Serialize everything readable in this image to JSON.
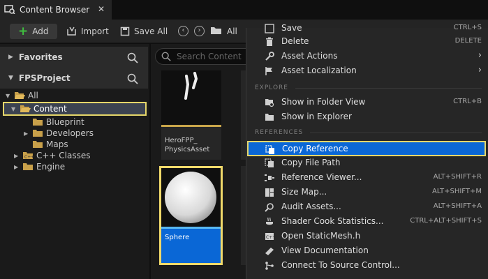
{
  "window": {
    "tab_title": "Content Browser",
    "close_glyph": "✕"
  },
  "toolbar": {
    "add_label": "Add",
    "import_label": "Import",
    "save_all_label": "Save All",
    "breadcrumb": "All"
  },
  "left_pane": {
    "favorites_label": "Favorites",
    "project_label": "FPSProject",
    "tree": [
      "All",
      "Content",
      "Blueprint",
      "Developers",
      "Maps",
      "C++ Classes",
      "Engine"
    ]
  },
  "assets": {
    "search_placeholder": "Search Content",
    "tiles": [
      {
        "line1": "HeroFPP_",
        "line2": "PhysicsAsset"
      },
      {
        "line1": "Sphere"
      }
    ]
  },
  "menu": {
    "partial_top": {
      "label": "Save",
      "shortcut": "CTRL+S"
    },
    "items_top": [
      {
        "label": "Delete",
        "shortcut": "DELETE",
        "icon": "trash-icon"
      },
      {
        "label": "Asset Actions",
        "submenu": "›",
        "icon": "wrench-icon"
      },
      {
        "label": "Asset Localization",
        "submenu": "›",
        "icon": "flag-icon"
      }
    ],
    "explore_header": "EXPLORE",
    "items_explore": [
      {
        "label": "Show in Folder View",
        "shortcut": "CTRL+B",
        "icon": "folder-view-icon"
      },
      {
        "label": "Show in Explorer",
        "shortcut": "",
        "icon": "folder-icon"
      }
    ],
    "references_header": "REFERENCES",
    "items_references": [
      {
        "label": "Copy Reference",
        "shortcut": "",
        "icon": "copy-reference-icon"
      },
      {
        "label": "Copy File Path",
        "shortcut": "",
        "icon": "copy-path-icon"
      },
      {
        "label": "Reference Viewer...",
        "shortcut": "ALT+SHIFT+R",
        "icon": "reference-viewer-icon"
      },
      {
        "label": "Size Map...",
        "shortcut": "ALT+SHIFT+M",
        "icon": "size-map-icon"
      },
      {
        "label": "Audit Assets...",
        "shortcut": "ALT+SHIFT+A",
        "icon": "audit-icon"
      },
      {
        "label": "Shader Cook Statistics...",
        "shortcut": "CTRL+ALT+SHIFT+S",
        "icon": "shader-icon"
      },
      {
        "label": "Open StaticMesh.h",
        "shortcut": "",
        "icon": "cpp-file-icon"
      },
      {
        "label": "View Documentation",
        "shortcut": "",
        "icon": "documentation-icon"
      },
      {
        "label": "Connect To Source Control...",
        "shortcut": "",
        "icon": "source-control-icon"
      }
    ]
  },
  "colors": {
    "highlight": "#0a67d6",
    "focus_outline": "#e5d66a",
    "add_plus": "#3fbf3f"
  }
}
